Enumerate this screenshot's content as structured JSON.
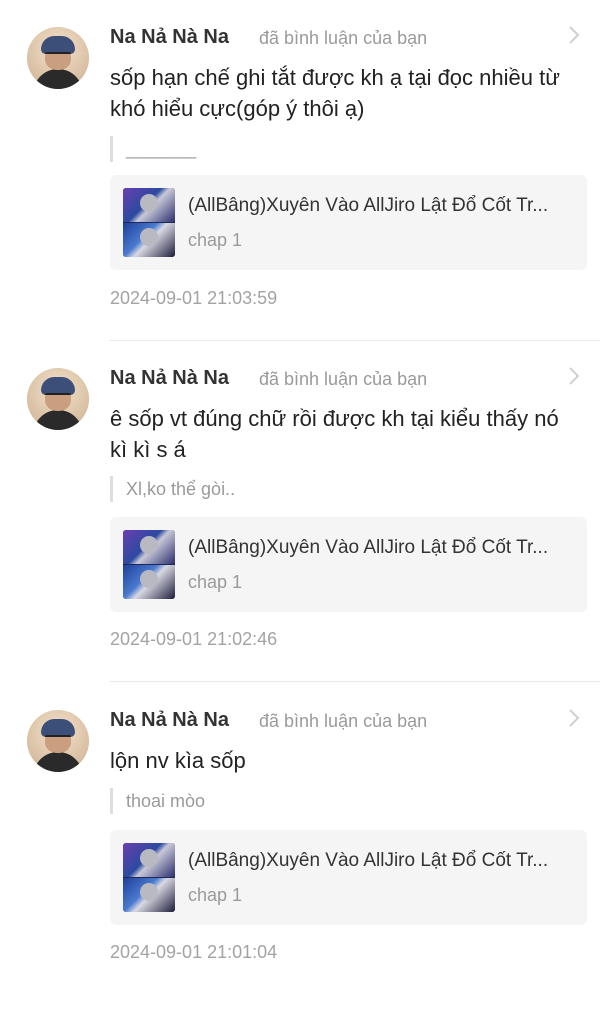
{
  "comments": [
    {
      "user_name": "Na Nả Nà Na",
      "action_text": "đã bình luận của bạn",
      "comment_text": "sốp hạn chế ghi tắt được kh ạ tại đọc nhiều từ khó hiểu cực(góp ý thôi ạ)",
      "quoted_reply": "_______",
      "story_title": "(AllBâng)Xuyên Vào AllJiro Lật Đổ Cốt Tr...",
      "chapter": "chap 1",
      "timestamp": "2024-09-01 21:03:59"
    },
    {
      "user_name": "Na Nả Nà Na",
      "action_text": "đã bình luận của bạn",
      "comment_text": "ê sốp vt đúng chữ rồi được kh tại kiểu thấy nó kì kì s á",
      "quoted_reply": "Xl,ko thể gòi..",
      "story_title": "(AllBâng)Xuyên Vào AllJiro Lật Đổ Cốt Tr...",
      "chapter": "chap 1",
      "timestamp": "2024-09-01 21:02:46"
    },
    {
      "user_name": "Na Nả Nà Na",
      "action_text": "đã bình luận của bạn",
      "comment_text": "lộn nv kìa sốp",
      "quoted_reply": "thoai mòo",
      "story_title": "(AllBâng)Xuyên Vào AllJiro Lật Đổ Cốt Tr...",
      "chapter": "chap 1",
      "timestamp": "2024-09-01 21:01:04"
    }
  ],
  "icons": {
    "avatar": "user-avatar",
    "chevron": "chevron-right-icon",
    "thumbnail": "story-cover-thumbnail"
  },
  "colors": {
    "name": "#333333",
    "muted": "#9a9a9a",
    "card_bg": "#f5f5f5",
    "quote_bar": "#dedede"
  }
}
